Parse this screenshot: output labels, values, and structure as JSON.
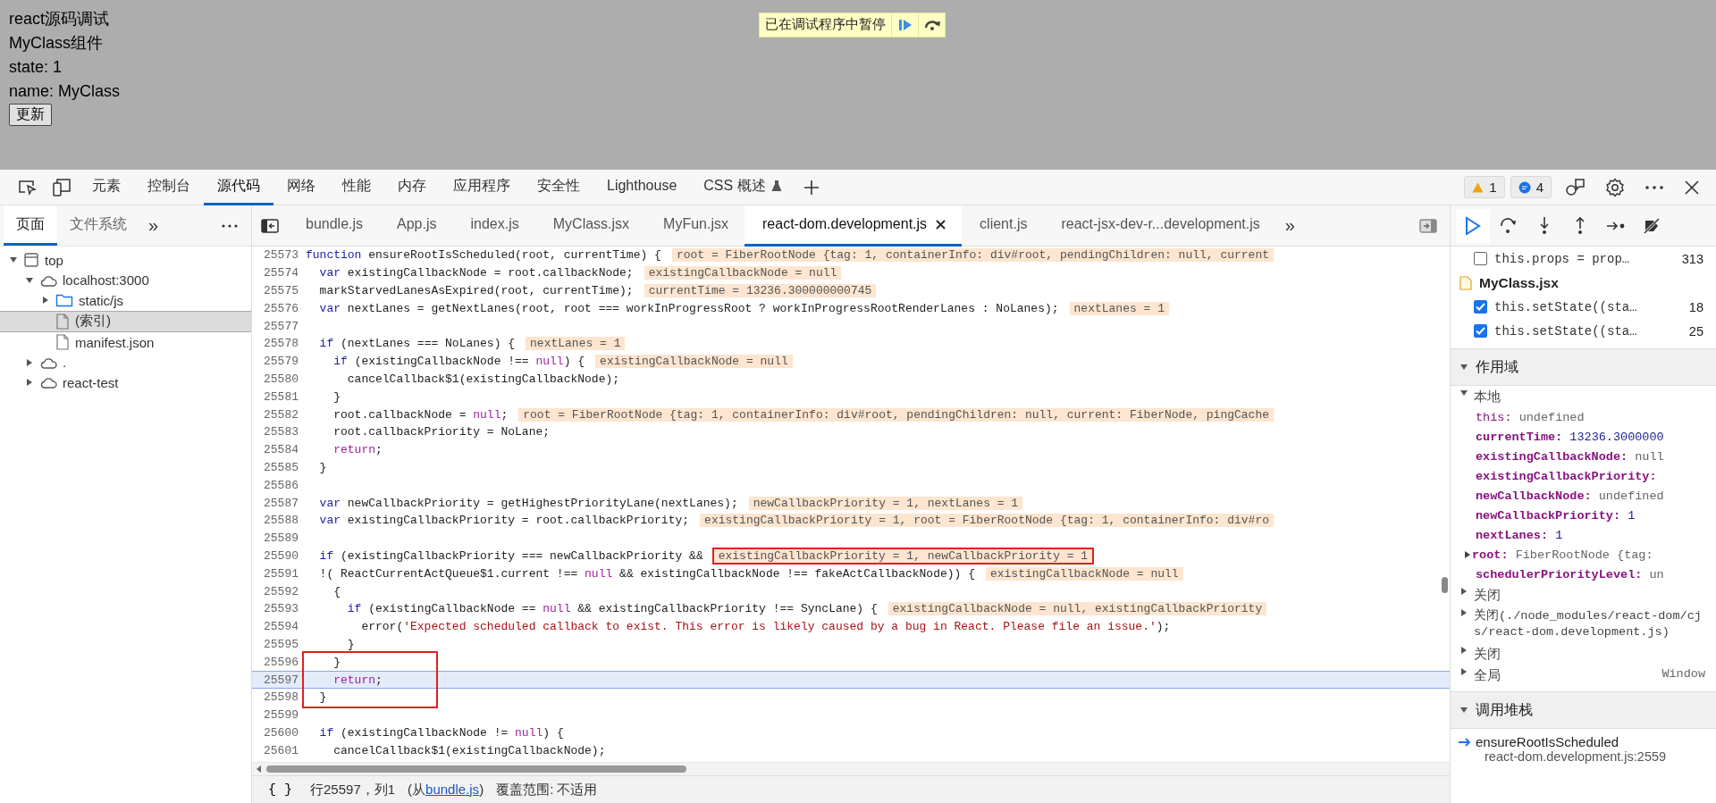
{
  "page": {
    "lines": [
      "react源码调试",
      "MyClass组件",
      "state: 1",
      "name: MyClass"
    ],
    "button": "更新"
  },
  "paused_overlay": {
    "message": "已在调试程序中暂停"
  },
  "devtools": {
    "tabs": [
      {
        "label": "元素",
        "selected": false,
        "kind": "plain"
      },
      {
        "label": "控制台",
        "selected": false,
        "kind": "plain"
      },
      {
        "label": "源代码",
        "selected": true,
        "kind": "plain"
      },
      {
        "label": "网络",
        "selected": false,
        "kind": "plain"
      },
      {
        "label": "性能",
        "selected": false,
        "kind": "plain"
      },
      {
        "label": "内存",
        "selected": false,
        "kind": "plain"
      },
      {
        "label": "应用程序",
        "selected": false,
        "kind": "plain"
      },
      {
        "label": "安全性",
        "selected": false,
        "kind": "plain"
      },
      {
        "label": "Lighthouse",
        "selected": false,
        "kind": "plain"
      },
      {
        "label": "CSS 概述",
        "selected": false,
        "kind": "experiment"
      }
    ],
    "warnings": "1",
    "messages": "4"
  },
  "sidebar": {
    "tabs": [
      {
        "label": "页面",
        "selected": true
      },
      {
        "label": "文件系统",
        "selected": false
      }
    ],
    "overflow": "»",
    "tree": [
      {
        "label": "top",
        "kind": "frame",
        "expanded": true,
        "selected": false,
        "children": [
          {
            "label": "localhost:3000",
            "kind": "cloud",
            "expanded": true,
            "selected": false,
            "children": [
              {
                "label": "static/js",
                "kind": "folder",
                "expanded": false,
                "selected": false
              },
              {
                "label": "(索引)",
                "kind": "file",
                "selected": true
              },
              {
                "label": "manifest.json",
                "kind": "file",
                "selected": false
              }
            ]
          },
          {
            "label": ".",
            "kind": "cloud",
            "expanded": false,
            "selected": false
          },
          {
            "label": "react-test",
            "kind": "cloud",
            "expanded": false,
            "selected": false
          }
        ]
      }
    ]
  },
  "editor": {
    "tabs": [
      {
        "label": "bundle.js",
        "selected": false
      },
      {
        "label": "App.js",
        "selected": false
      },
      {
        "label": "index.js",
        "selected": false
      },
      {
        "label": "MyClass.jsx",
        "selected": false
      },
      {
        "label": "MyFun.jsx",
        "selected": false
      },
      {
        "label": "react-dom.development.js",
        "selected": true
      },
      {
        "label": "client.js",
        "selected": false
      },
      {
        "label": "react-jsx-dev-r...development.js",
        "selected": false
      }
    ],
    "overflow": "»",
    "lines": [
      {
        "n": "25573",
        "code": "function ensureRootIsScheduled(root, currentTime) {",
        "value": "root = FiberRootNode {tag: 1, containerInfo: div#root, pendingChildren: null, current",
        "value_boxed": false,
        "current": false,
        "boxed": false
      },
      {
        "n": "25574",
        "code": "  var existingCallbackNode = root.callbackNode;",
        "value": "existingCallbackNode = null",
        "value_boxed": false,
        "current": false,
        "boxed": false
      },
      {
        "n": "25575",
        "code": "  markStarvedLanesAsExpired(root, currentTime);",
        "value": "currentTime = 13236.300000000745",
        "value_boxed": false,
        "current": false,
        "boxed": false
      },
      {
        "n": "25576",
        "code": "  var nextLanes = getNextLanes(root, root === workInProgressRoot ? workInProgressRootRenderLanes : NoLanes);",
        "value": "nextLanes = 1",
        "value_boxed": false,
        "current": false,
        "boxed": false
      },
      {
        "n": "25577",
        "current": false,
        "boxed": false
      },
      {
        "n": "25578",
        "code": "  if (nextLanes === NoLanes) {",
        "value": "nextLanes = 1",
        "value_boxed": false,
        "current": false,
        "boxed": false
      },
      {
        "n": "25579",
        "code": "    if (existingCallbackNode !== null) {",
        "value": "existingCallbackNode = null",
        "value_boxed": false,
        "current": false,
        "boxed": false
      },
      {
        "n": "25580",
        "code": "      cancelCallback$1(existingCallbackNode);",
        "current": false,
        "boxed": false
      },
      {
        "n": "25581",
        "code": "    }",
        "current": false,
        "boxed": false
      },
      {
        "n": "25582",
        "code": "    root.callbackNode = null;",
        "value": "root = FiberRootNode {tag: 1, containerInfo: div#root, pendingChildren: null, current: FiberNode, pingCache",
        "value_boxed": false,
        "current": false,
        "boxed": false
      },
      {
        "n": "25583",
        "code": "    root.callbackPriority = NoLane;",
        "current": false,
        "boxed": false
      },
      {
        "n": "25584",
        "code": "    return;",
        "current": false,
        "boxed": false
      },
      {
        "n": "25585",
        "code": "  }",
        "current": false,
        "boxed": false
      },
      {
        "n": "25586",
        "current": false,
        "boxed": false
      },
      {
        "n": "25587",
        "code": "  var newCallbackPriority = getHighestPriorityLane(nextLanes);",
        "value": "newCallbackPriority = 1, nextLanes = 1",
        "value_boxed": false,
        "current": false,
        "boxed": false
      },
      {
        "n": "25588",
        "code": "  var existingCallbackPriority = root.callbackPriority;",
        "value": "existingCallbackPriority = 1, root = FiberRootNode {tag: 1, containerInfo: div#ro",
        "value_boxed": false,
        "current": false,
        "boxed": false
      },
      {
        "n": "25589",
        "current": false,
        "boxed": false
      },
      {
        "n": "25590",
        "code": "  if (existingCallbackPriority === newCallbackPriority &&",
        "value": "existingCallbackPriority = 1, newCallbackPriority = 1",
        "value_boxed": true,
        "current": false,
        "boxed": false
      },
      {
        "n": "25591",
        "code": "  !( ReactCurrentActQueue$1.current !== null && existingCallbackNode !== fakeActCallbackNode)) {",
        "value": "existingCallbackNode = null",
        "value_boxed": false,
        "current": false,
        "boxed": false
      },
      {
        "n": "25592",
        "code": "    {",
        "current": false,
        "boxed": false
      },
      {
        "n": "25593",
        "code": "      if (existingCallbackNode == null && existingCallbackPriority !== SyncLane) {",
        "value": "existingCallbackNode = null, existingCallbackPriority",
        "value_boxed": false,
        "current": false,
        "boxed": false
      },
      {
        "n": "25594",
        "code": "        error('Expected scheduled callback to exist. This error is likely caused by a bug in React. Please file an issue.');",
        "current": false,
        "boxed": false
      },
      {
        "n": "25595",
        "code": "      }",
        "current": false,
        "boxed": false
      },
      {
        "n": "25596",
        "code": "    }",
        "current": false,
        "boxed": true
      },
      {
        "n": "25597",
        "code": "    return;",
        "current": true,
        "boxed": true
      },
      {
        "n": "25598",
        "code": "  }",
        "current": false,
        "boxed": true
      },
      {
        "n": "25599",
        "current": false,
        "boxed": false
      },
      {
        "n": "25600",
        "code": "  if (existingCallbackNode != null) {",
        "current": false,
        "boxed": false
      },
      {
        "n": "25601",
        "code": "    cancelCallback$1(existingCallbackNode);",
        "current": false,
        "boxed": false
      }
    ]
  },
  "status_bar": {
    "pretty_print": "{ }",
    "position": "行25597，列1",
    "source_before": "(从",
    "source_link": "bundle.js",
    "source_after": ")",
    "coverage": "覆盖范围: 不适用"
  },
  "debugger": {
    "breakpoints": [
      {
        "kind": "breakpoint",
        "text": "this.props = prop…",
        "line": "313",
        "checked": false
      },
      {
        "kind": "file",
        "text": "MyClass.jsx"
      },
      {
        "kind": "breakpoint",
        "text": "this.setState((sta…",
        "line": "18",
        "checked": true
      },
      {
        "kind": "breakpoint",
        "text": "this.setState((sta…",
        "line": "25",
        "checked": true
      }
    ],
    "scope": {
      "title": "作用域",
      "expanded": true,
      "groups": [
        {
          "label": "本地",
          "expanded": true,
          "variables": [
            {
              "name": "this:",
              "value": "undefined",
              "kind": "receiver",
              "numeric": false,
              "expandable": false
            },
            {
              "name": "currentTime:",
              "value": "13236.3000000",
              "kind": "local",
              "numeric": true,
              "expandable": false
            },
            {
              "name": "existingCallbackNode:",
              "value": "null",
              "kind": "local",
              "numeric": false,
              "expandable": false
            },
            {
              "name": "existingCallbackPriority:",
              "kind": "local",
              "expandable": false
            },
            {
              "name": "newCallbackNode:",
              "value": "undefined",
              "kind": "local",
              "numeric": false,
              "expandable": false
            },
            {
              "name": "newCallbackPriority:",
              "value": "1",
              "kind": "local",
              "numeric": true,
              "expandable": false
            },
            {
              "name": "nextLanes:",
              "value": "1",
              "kind": "local",
              "numeric": true,
              "expandable": false
            },
            {
              "name": "root:",
              "value": "FiberRootNode {tag:",
              "kind": "local",
              "numeric": false,
              "expandable": true
            },
            {
              "name": "schedulerPriorityLevel:",
              "value": "un",
              "kind": "local",
              "numeric": false,
              "expandable": false
            }
          ]
        },
        {
          "label": "关闭",
          "expanded": false
        },
        {
          "label": "关闭(./node_modules/react-dom/cjs/react-dom.development.js)",
          "expanded": false
        },
        {
          "label": "关闭",
          "expanded": false
        },
        {
          "label": "全局",
          "value": "Window",
          "expanded": false
        }
      ]
    },
    "call_stack": {
      "title": "调用堆栈",
      "expanded": true,
      "frames": [
        {
          "name": "ensureRootIsScheduled",
          "location": "react-dom.development.js:2559",
          "current": true
        }
      ]
    }
  }
}
